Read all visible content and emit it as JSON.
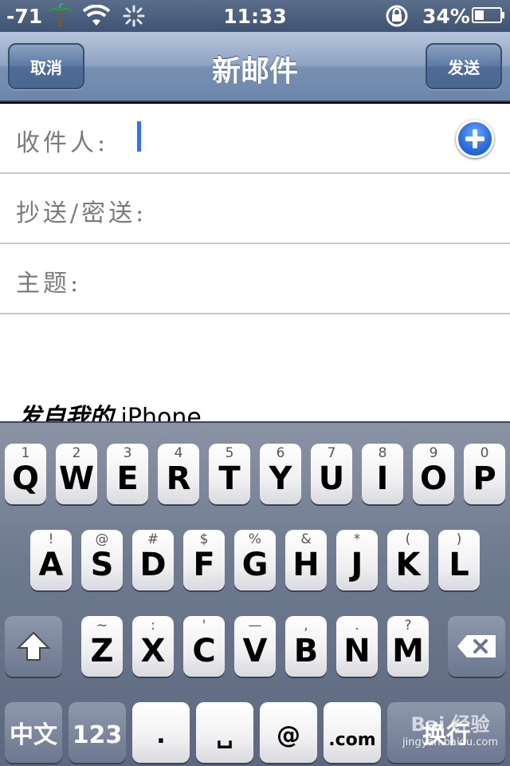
{
  "status_bar": {
    "signal": "-71",
    "time": "11:33",
    "battery_percent": "34%",
    "icons": [
      "palm-tree-icon",
      "wifi-icon",
      "activity-spinner-icon",
      "rotation-lock-icon",
      "battery-icon"
    ]
  },
  "nav": {
    "cancel_label": "取消",
    "title": "新邮件",
    "send_label": "发送"
  },
  "fields": {
    "to_label": "收件人:",
    "cc_bcc_label": "抄送/密送:",
    "subject_label": "主题:",
    "to_value": "",
    "subject_value": ""
  },
  "body": {
    "signature_cn": "发自我的",
    "signature_device": "iPhone"
  },
  "keyboard": {
    "row1": [
      {
        "main": "Q",
        "alt": "1"
      },
      {
        "main": "W",
        "alt": "2"
      },
      {
        "main": "E",
        "alt": "3"
      },
      {
        "main": "R",
        "alt": "4"
      },
      {
        "main": "T",
        "alt": "5"
      },
      {
        "main": "Y",
        "alt": "6"
      },
      {
        "main": "U",
        "alt": "7"
      },
      {
        "main": "I",
        "alt": "8"
      },
      {
        "main": "O",
        "alt": "9"
      },
      {
        "main": "P",
        "alt": "0"
      }
    ],
    "row2": [
      {
        "main": "A",
        "alt": "!"
      },
      {
        "main": "S",
        "alt": "@"
      },
      {
        "main": "D",
        "alt": "#"
      },
      {
        "main": "F",
        "alt": "$"
      },
      {
        "main": "G",
        "alt": "%"
      },
      {
        "main": "H",
        "alt": "&"
      },
      {
        "main": "J",
        "alt": "*"
      },
      {
        "main": "K",
        "alt": "("
      },
      {
        "main": "L",
        "alt": ")"
      }
    ],
    "row3": [
      {
        "main": "Z",
        "alt": "~"
      },
      {
        "main": "X",
        "alt": ":"
      },
      {
        "main": "C",
        "alt": "'"
      },
      {
        "main": "V",
        "alt": "—"
      },
      {
        "main": "B",
        "alt": ","
      },
      {
        "main": "N",
        "alt": "."
      },
      {
        "main": "M",
        "alt": "?"
      }
    ],
    "lang_label": "中文",
    "numbers_label": "123",
    "period_label": ".",
    "space_label": "␣",
    "at_label": "@",
    "com_label": ".com",
    "return_label": "换行"
  },
  "watermark": {
    "logo": "Bai 经验",
    "url": "jingyan.baidu.com"
  }
}
